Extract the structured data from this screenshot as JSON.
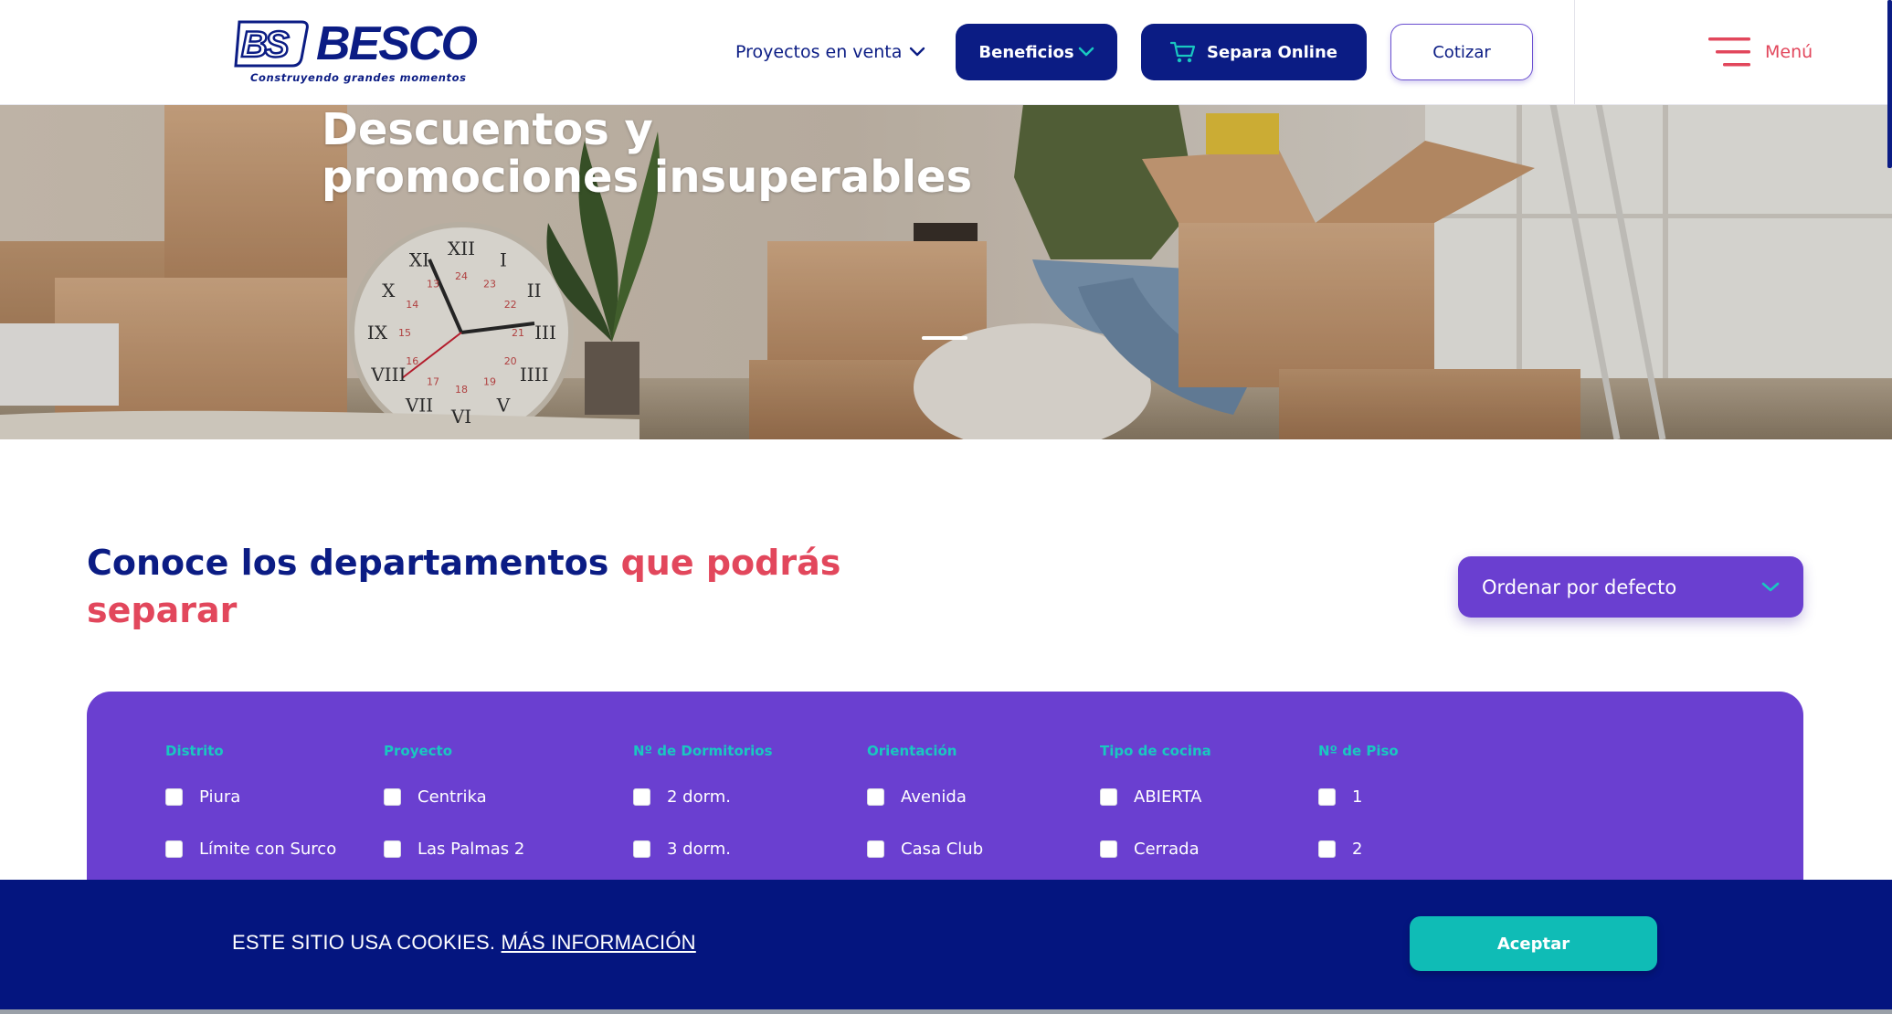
{
  "header": {
    "logo_text": "BESCO",
    "logo_mark": "BS",
    "logo_tagline": "Construyendo grandes momentos",
    "nav_projects": "Proyectos en venta",
    "beneficios": "Beneficios",
    "separa_online": "Separa Online",
    "cotizar": "Cotizar",
    "menu": "Menú"
  },
  "hero": {
    "title": "Descuentos y promociones insuperables",
    "clock_numbers": [
      "XII",
      "I",
      "II",
      "III",
      "IIII",
      "V",
      "VI",
      "VII",
      "VIII",
      "IX",
      "X",
      "XI",
      "24",
      "23",
      "22",
      "21",
      "20",
      "19",
      "18",
      "17",
      "16",
      "15",
      "14",
      "13"
    ]
  },
  "section": {
    "title_part1": "Conoce los departamentos ",
    "title_part2": "que podrás separar",
    "sort_label": "Ordenar por defecto"
  },
  "filters": {
    "columns": [
      {
        "heading": "Distrito",
        "options": [
          "Piura",
          "Límite con Surco"
        ]
      },
      {
        "heading": "Proyecto",
        "options": [
          "Centrika",
          "Las Palmas 2"
        ]
      },
      {
        "heading": "Nº de Dormitorios",
        "options": [
          "2 dorm.",
          "3 dorm."
        ]
      },
      {
        "heading": "Orientación",
        "options": [
          "Avenida",
          "Casa Club"
        ]
      },
      {
        "heading": "Tipo de cocina",
        "options": [
          "ABIERTA",
          "Cerrada"
        ]
      },
      {
        "heading": "Nº de Piso",
        "options": [
          "1",
          "2"
        ]
      }
    ]
  },
  "cookies": {
    "text": "ESTE SITIO USA COOKIES. ",
    "link": "MÁS INFORMACIÓN",
    "accept": "Aceptar"
  },
  "colors": {
    "brand_navy": "#0b1c84",
    "accent_red": "#e2475c",
    "panel_purple": "#6a3fd0",
    "teal": "#19c8c0",
    "cookie_bg": "#04157f",
    "accept_teal": "#0fbcb6"
  },
  "icons": {
    "nav_projects": "chevron-down-icon",
    "beneficios": "chevron-down-icon",
    "separa_online": "cart-icon",
    "menu": "hamburger-icon",
    "sort": "chevron-down-icon"
  }
}
